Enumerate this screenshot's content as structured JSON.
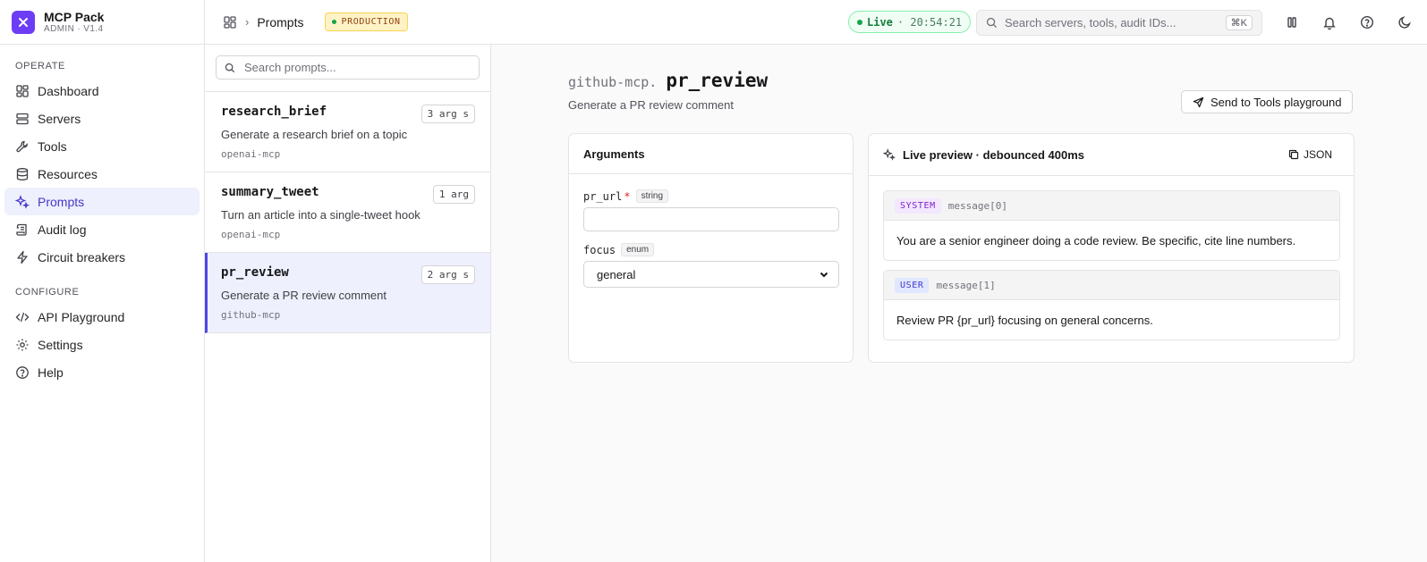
{
  "brand": {
    "name": "MCP Pack",
    "sub": "ADMIN · V1.4"
  },
  "sidebar": {
    "sections": [
      {
        "title": "OPERATE",
        "items": [
          {
            "label": "Dashboard",
            "icon": "dashboard-icon"
          },
          {
            "label": "Servers",
            "icon": "server-icon"
          },
          {
            "label": "Tools",
            "icon": "wrench-icon"
          },
          {
            "label": "Resources",
            "icon": "database-icon"
          },
          {
            "label": "Prompts",
            "icon": "sparkles-icon",
            "active": true
          },
          {
            "label": "Audit log",
            "icon": "scroll-icon"
          },
          {
            "label": "Circuit breakers",
            "icon": "zap-icon"
          }
        ]
      },
      {
        "title": "CONFIGURE",
        "items": [
          {
            "label": "API Playground",
            "icon": "code-icon"
          },
          {
            "label": "Settings",
            "icon": "gear-icon"
          },
          {
            "label": "Help",
            "icon": "help-icon"
          }
        ]
      }
    ]
  },
  "header": {
    "breadcrumb": "Prompts",
    "env_badge": "PRODUCTION",
    "live_label": "Live",
    "live_time": "· 20:54:21",
    "search_placeholder": "Search servers, tools, audit IDs...",
    "search_shortcut": "⌘K"
  },
  "list": {
    "search_placeholder": "Search prompts...",
    "items": [
      {
        "name": "research_brief",
        "args": "3 arg s",
        "desc": "Generate a research brief on a topic",
        "server": "openai-mcp"
      },
      {
        "name": "summary_tweet",
        "args": "1 arg",
        "desc": "Turn an article into a single-tweet hook",
        "server": "openai-mcp"
      },
      {
        "name": "pr_review",
        "args": "2 arg s",
        "desc": "Generate a PR review comment",
        "server": "github-mcp",
        "active": true
      }
    ]
  },
  "detail": {
    "prefix": "github-mcp.",
    "name": "pr_review",
    "subtitle": "Generate a PR review comment",
    "send_label": "Send to Tools playground",
    "args_title": "Arguments",
    "fields": [
      {
        "name": "pr_url",
        "required": "*",
        "type": "string",
        "value": ""
      },
      {
        "name": "focus",
        "type": "enum",
        "value": "general"
      }
    ],
    "preview_title": "Live preview · debounced 400ms",
    "json_label": "JSON",
    "messages": [
      {
        "role": "SYSTEM",
        "index": "message[0]",
        "text": "You are a senior engineer doing a code review. Be specific, cite line numbers."
      },
      {
        "role": "USER",
        "index": "message[1]",
        "text": "Review PR {pr_url} focusing on general concerns."
      }
    ]
  },
  "colors": {
    "accent": "#4f46e5",
    "brand": "#6d3df5",
    "live": "#16a34a",
    "env": "#fef3c7"
  }
}
